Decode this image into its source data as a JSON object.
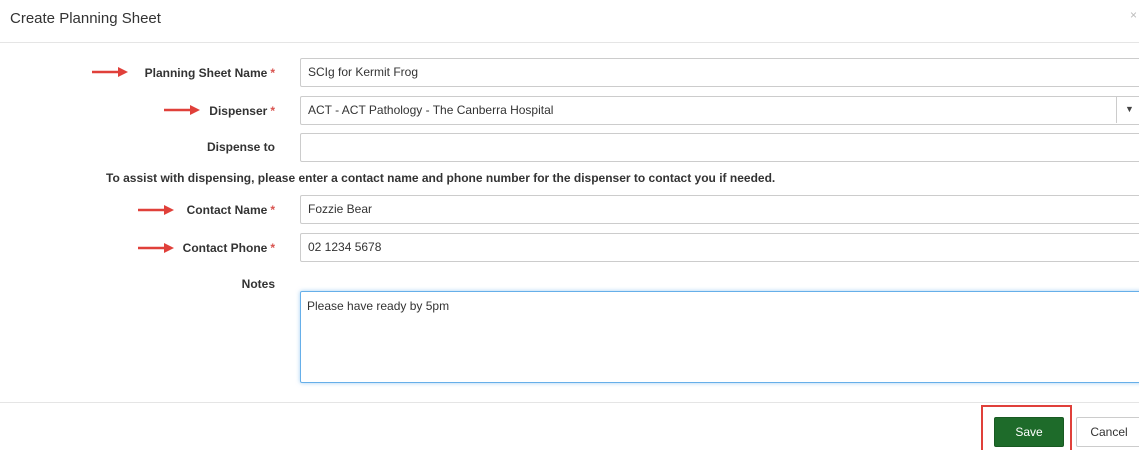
{
  "dialog": {
    "title": "Create Planning Sheet",
    "close_glyph": "×"
  },
  "form": {
    "planning_sheet_name": {
      "label": "Planning Sheet Name",
      "required_mark": "*",
      "value": "SCIg for Kermit Frog"
    },
    "dispenser": {
      "label": "Dispenser",
      "required_mark": "*",
      "value": "ACT - ACT Pathology - The Canberra Hospital"
    },
    "dispense_to": {
      "label": "Dispense to",
      "value": ""
    },
    "instruction": "To assist with dispensing, please enter a contact name and phone number for the dispenser to contact you if needed.",
    "contact_name": {
      "label": "Contact Name",
      "required_mark": "*",
      "value": "Fozzie Bear"
    },
    "contact_phone": {
      "label": "Contact Phone",
      "required_mark": "*",
      "value": "02 1234 5678"
    },
    "notes": {
      "label": "Notes",
      "value": "Please have ready by 5pm"
    }
  },
  "footer": {
    "save_label": "Save",
    "cancel_label": "Cancel"
  },
  "colors": {
    "annotation_red": "#e0403a",
    "save_green": "#1e6b2a",
    "required_red": "#d9534f",
    "focus_blue": "#66afe9"
  }
}
